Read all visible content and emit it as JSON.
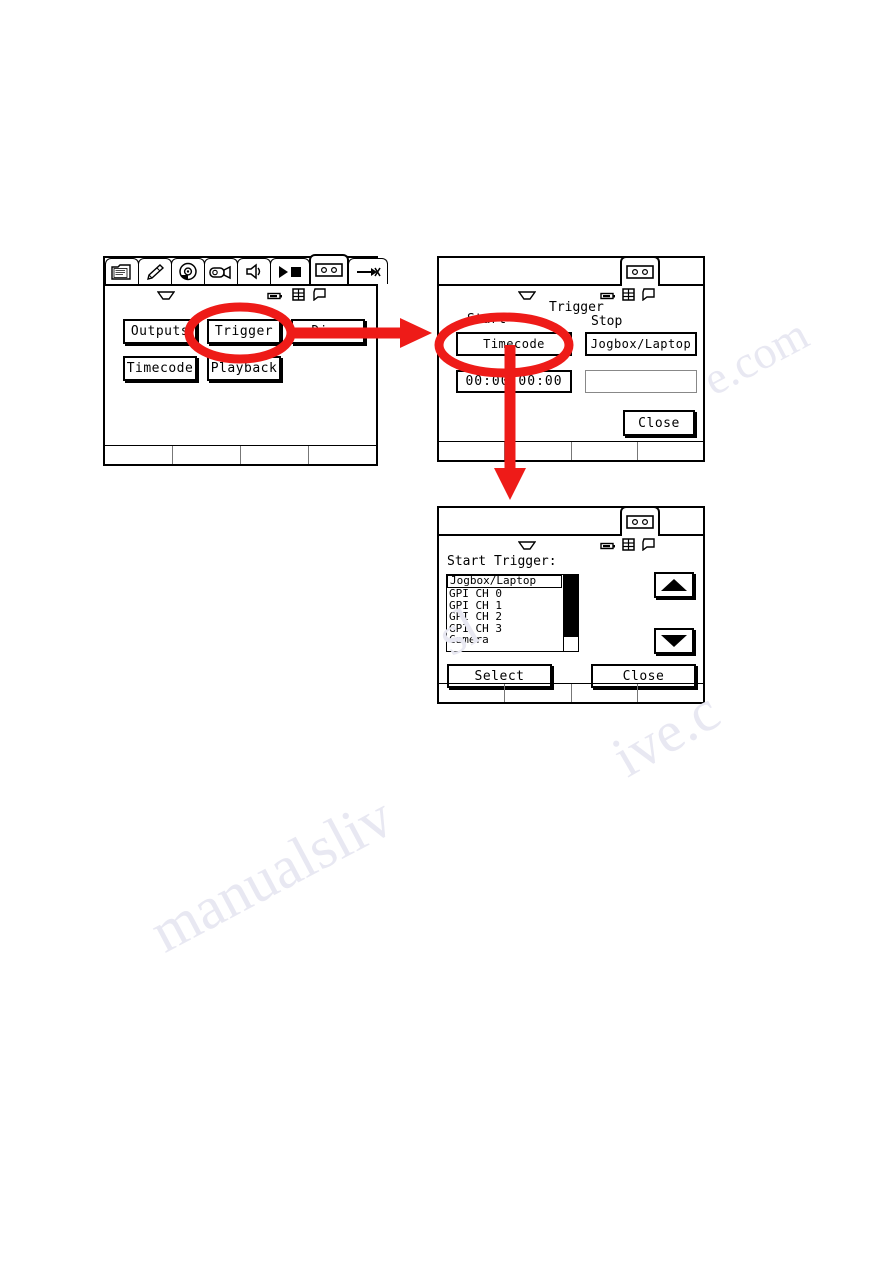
{
  "document": {
    "watermark": "manualslive.com"
  },
  "panel1": {
    "name": "main-menu-screen",
    "tabs": [
      {
        "id": "tab-file",
        "icon": "document-icon",
        "active": false
      },
      {
        "id": "tab-tools",
        "icon": "screwdriver-icon",
        "active": false
      },
      {
        "id": "tab-disc",
        "icon": "disc-icon",
        "active": false
      },
      {
        "id": "tab-camera",
        "icon": "camera-icon",
        "active": false
      },
      {
        "id": "tab-audio",
        "icon": "speaker-icon",
        "active": false
      },
      {
        "id": "tab-transport",
        "icon": "play-stop-icon",
        "active": false
      },
      {
        "id": "tab-cassette",
        "icon": "cassette-icon",
        "active": true
      },
      {
        "id": "tab-exit",
        "icon": "arrow-exit-icon",
        "active": false
      }
    ],
    "indicators": [
      {
        "id": "indicator-trapezoid",
        "icon": "trapezoid-icon"
      },
      {
        "id": "indicator-battery",
        "icon": "battery-icon"
      },
      {
        "id": "indicator-grid",
        "icon": "grid-icon"
      },
      {
        "id": "indicator-page",
        "icon": "page-icon"
      }
    ],
    "buttons": {
      "outputs": "Outputs",
      "trigger": "Trigger",
      "disc": "Disc",
      "timecode": "Timecode",
      "playback": "Playback"
    }
  },
  "panel2": {
    "name": "trigger-screen",
    "tabs": [
      {
        "id": "tab-cassette",
        "icon": "cassette-icon",
        "active": true
      }
    ],
    "indicators": [
      {
        "id": "indicator-trapezoid",
        "icon": "trapezoid-icon"
      },
      {
        "id": "indicator-battery",
        "icon": "battery-icon"
      },
      {
        "id": "indicator-grid",
        "icon": "grid-icon"
      },
      {
        "id": "indicator-page",
        "icon": "page-icon"
      }
    ],
    "title": "Trigger",
    "start_label": "Start",
    "stop_label": "Stop",
    "start_value": "Timecode",
    "stop_value": "Jogbox/Laptop",
    "start_timecode": "00:00:00:00",
    "stop_timecode": "",
    "close": "Close"
  },
  "panel3": {
    "name": "start-trigger-picker-screen",
    "tabs": [
      {
        "id": "tab-cassette",
        "icon": "cassette-icon",
        "active": true
      }
    ],
    "indicators": [
      {
        "id": "indicator-trapezoid",
        "icon": "trapezoid-icon"
      },
      {
        "id": "indicator-battery",
        "icon": "battery-icon"
      },
      {
        "id": "indicator-grid",
        "icon": "grid-icon"
      },
      {
        "id": "indicator-page",
        "icon": "page-icon"
      }
    ],
    "heading": "Start Trigger:",
    "list": [
      {
        "label": "Jogbox/Laptop",
        "selected": true
      },
      {
        "label": "GPI CH 0",
        "selected": false
      },
      {
        "label": "GPI CH 1",
        "selected": false
      },
      {
        "label": "GPI CH 2",
        "selected": false
      },
      {
        "label": "GPI CH 3",
        "selected": false
      },
      {
        "label": "Camera",
        "selected": false
      }
    ],
    "scroll_up": "scroll-up-arrow",
    "scroll_down": "scroll-down-arrow",
    "select": "Select",
    "close": "Close"
  },
  "annotations": {
    "highlight_color": "#ee1b18",
    "ellipse_trigger_button": "Trigger",
    "ellipse_timecode_button": "Timecode",
    "arrow_1": "panel1-to-panel2",
    "arrow_2": "panel2-to-panel3"
  }
}
